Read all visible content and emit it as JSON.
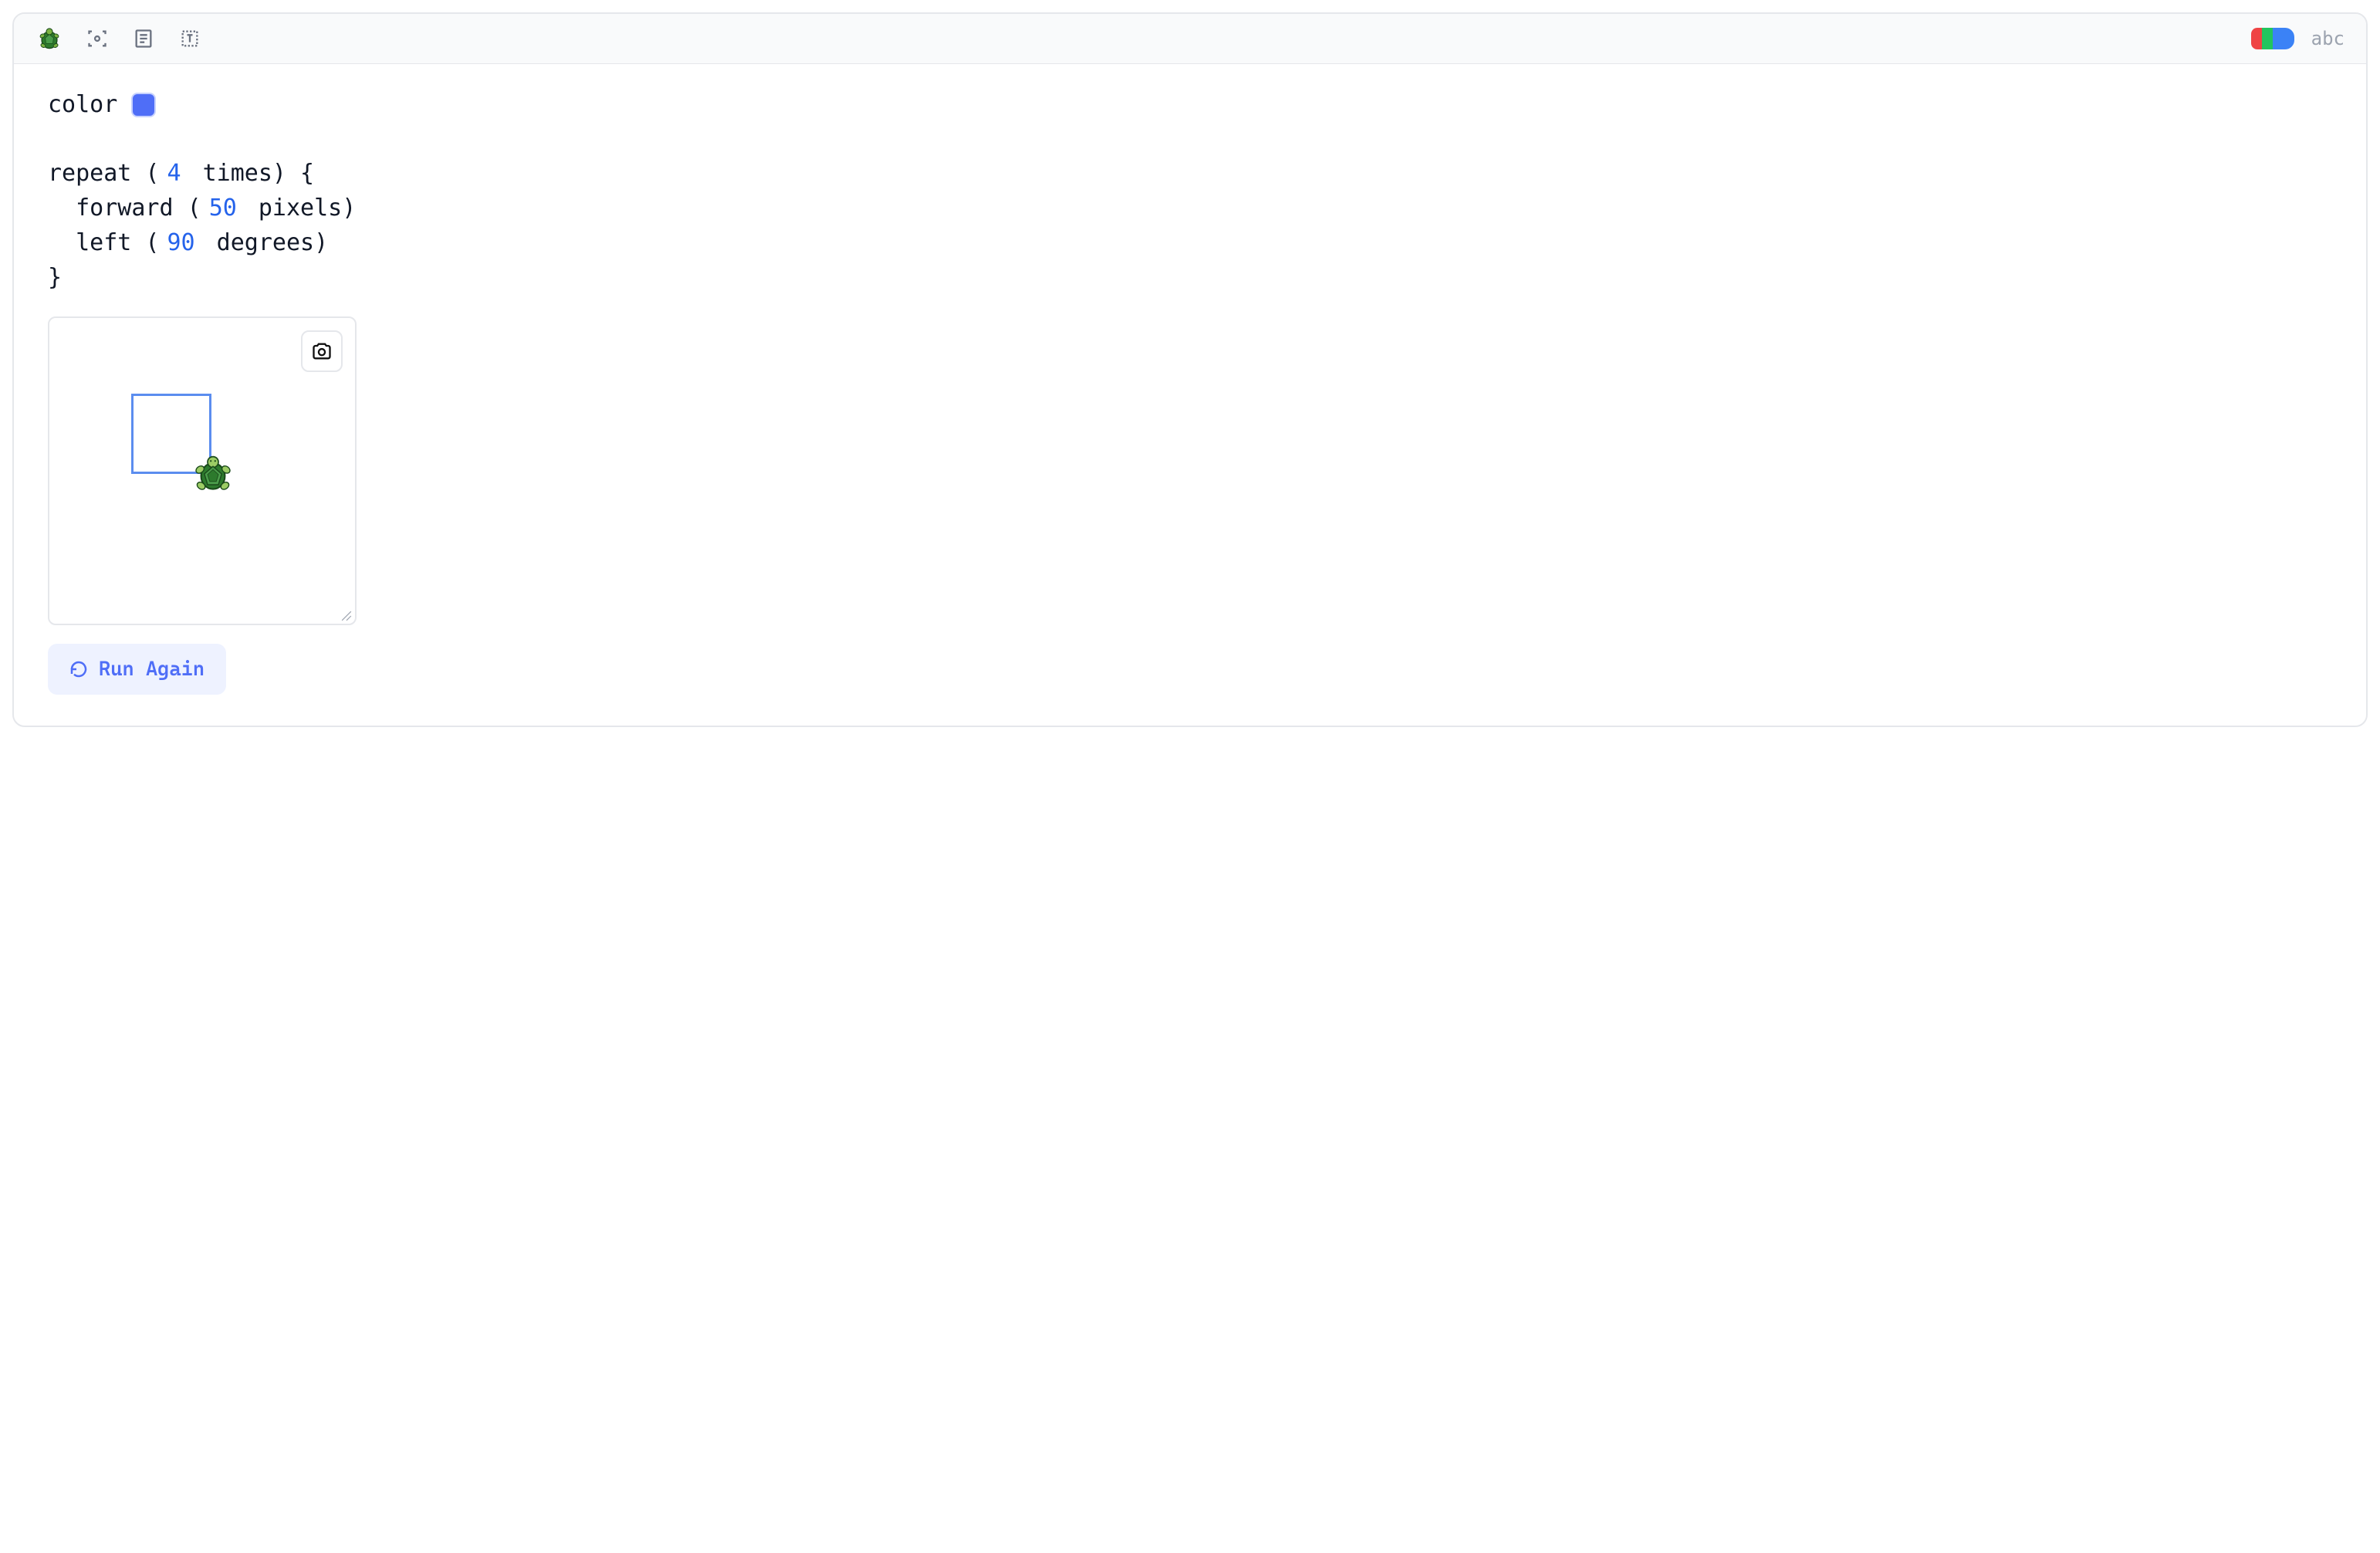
{
  "toolbar": {
    "abc_label": "abc"
  },
  "code": {
    "color_kw": "color",
    "color_value": "#4f6ef7",
    "repeat_open_a": "repeat (",
    "repeat_count": "4",
    "repeat_open_b": " times) {",
    "forward_a": "  forward (",
    "forward_val": "50",
    "forward_b": " pixels)",
    "left_a": "  left (",
    "left_val": "90",
    "left_b": " degrees)",
    "close": "}"
  },
  "canvas": {
    "square_color": "#5b8def",
    "square_size_px": 50
  },
  "actions": {
    "run_label": "Run Again"
  }
}
